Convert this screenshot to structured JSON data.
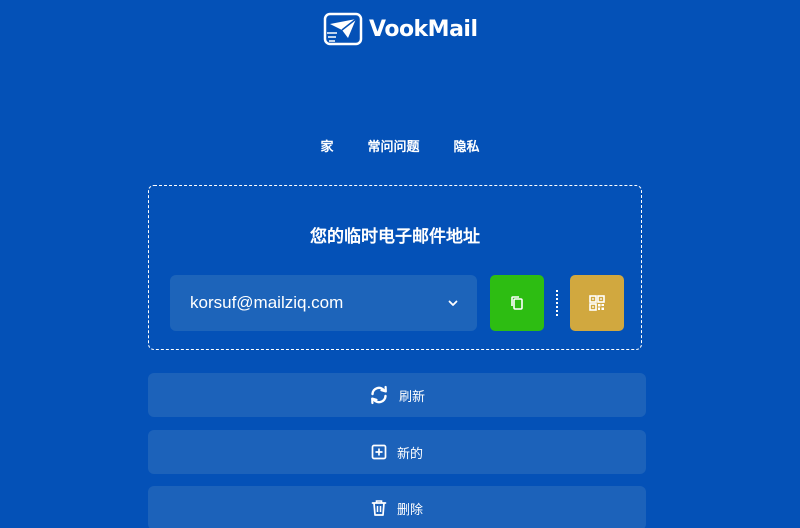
{
  "brand": {
    "name": "VookMail"
  },
  "nav": {
    "items": [
      {
        "label": "家"
      },
      {
        "label": "常问问题"
      },
      {
        "label": "隐私"
      }
    ]
  },
  "email_box": {
    "title": "您的临时电子邮件地址",
    "selected_email": "korsuf@mailziq.com"
  },
  "actions": {
    "refresh_label": "刷新",
    "new_label": "新的",
    "delete_label": "删除"
  },
  "colors": {
    "background": "#0451b7",
    "panel": "#1d64ba",
    "copy_button": "#2dbd12",
    "qr_button": "#d1a83f"
  },
  "icons": {
    "copy": "copy-icon",
    "qr": "qr-code-icon",
    "refresh": "refresh-icon",
    "new": "plus-square-icon",
    "delete": "trash-icon",
    "dropdown": "chevron-down-icon"
  }
}
